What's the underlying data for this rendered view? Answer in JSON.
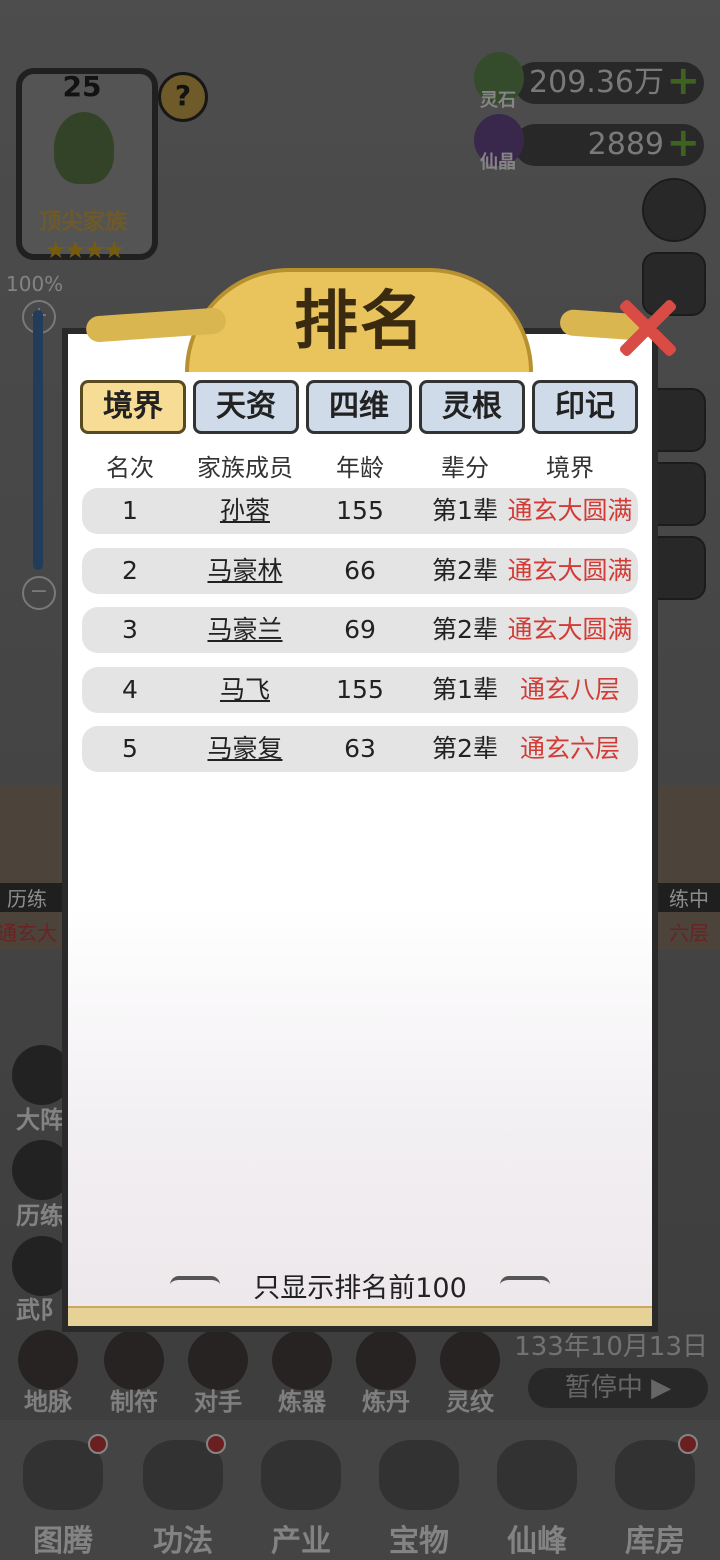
{
  "family": {
    "level": "25",
    "title": "顶尖家族",
    "stars": "★★★★"
  },
  "resources": {
    "spirit_stone_label": "灵石",
    "spirit_stone_value": "209.36万",
    "crystal_label": "仙晶",
    "crystal_value": "2889"
  },
  "zoom": {
    "percent": "100%"
  },
  "background_chars": {
    "left_status": "历练",
    "left_realm": "通玄大",
    "right_status": "练中",
    "right_realm": "六层"
  },
  "side_tools": [
    {
      "label": "大阵"
    },
    {
      "label": "历练"
    },
    {
      "label": "武阝"
    }
  ],
  "skills": [
    "地脉",
    "制符",
    "对手",
    "炼器",
    "炼丹",
    "灵纹"
  ],
  "game_date": "133年10月13日",
  "pause_label": "暂停中",
  "bottom_nav": [
    "图腾",
    "功法",
    "产业",
    "宝物",
    "仙峰",
    "库房"
  ],
  "modal": {
    "title": "排名",
    "tabs": [
      "境界",
      "天资",
      "四维",
      "灵根",
      "印记"
    ],
    "active_tab": "境界",
    "columns": [
      "名次",
      "家族成员",
      "年龄",
      "辈分",
      "境界"
    ],
    "rows": [
      {
        "rank": "1",
        "name": "孙蓉",
        "age": "155",
        "generation": "第1辈",
        "realm": "通玄大圆满"
      },
      {
        "rank": "2",
        "name": "马豪林",
        "age": "66",
        "generation": "第2辈",
        "realm": "通玄大圆满"
      },
      {
        "rank": "3",
        "name": "马豪兰",
        "age": "69",
        "generation": "第2辈",
        "realm": "通玄大圆满"
      },
      {
        "rank": "4",
        "name": "马飞",
        "age": "155",
        "generation": "第1辈",
        "realm": "通玄八层"
      },
      {
        "rank": "5",
        "name": "马豪复",
        "age": "63",
        "generation": "第2辈",
        "realm": "通玄六层"
      }
    ],
    "footer_note": "只显示排名前100"
  }
}
